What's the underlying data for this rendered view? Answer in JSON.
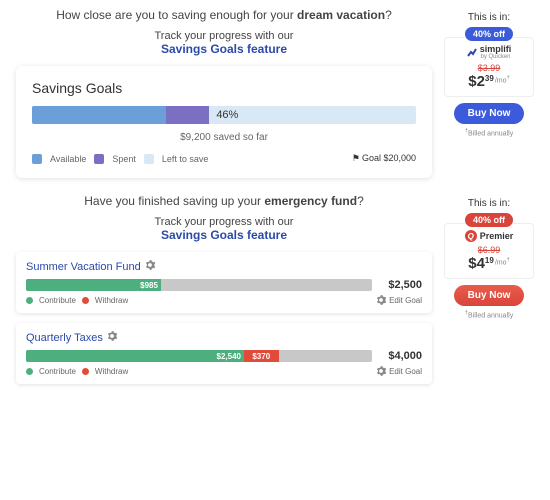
{
  "section1": {
    "prompt_pre": "How close are you to saving enough for your ",
    "prompt_bold": "dream vacation",
    "prompt_post": "?",
    "tagline": "Track your progress with our",
    "feature": "Savings Goals feature",
    "card": {
      "title": "Savings Goals",
      "pct": "46%",
      "saved": "$9,200 saved so far",
      "legend_available": "Available",
      "legend_spent": "Spent",
      "legend_left": "Left to save",
      "goal": "Goal $20,000"
    },
    "offer": {
      "this_in": "This is in:",
      "pct_off": "40% off",
      "brand": "simplifi",
      "brand_sub": "by Quicken",
      "old_price": "$3.99",
      "price_main": "$2",
      "price_cents": "39",
      "per": "/mo",
      "per_sup": "†",
      "buy": "Buy Now",
      "bill": "Billed annually",
      "bill_sup": "†"
    }
  },
  "section2": {
    "prompt_pre": "Have you finished saving up your ",
    "prompt_bold": "emergency fund",
    "prompt_post": "?",
    "tagline": "Track your progress with our",
    "feature": "Savings Goals feature",
    "goals": [
      {
        "name": "Summer Vacation Fund",
        "green": "$985",
        "green_w": 39,
        "red": "",
        "red_w": 0,
        "total": "$2,500"
      },
      {
        "name": "Quarterly Taxes",
        "green": "$2,540",
        "green_w": 63,
        "red": "$370",
        "red_w": 10,
        "total": "$4,000"
      }
    ],
    "legend": {
      "contribute": "Contribute",
      "withdraw": "Withdraw",
      "edit": "Edit Goal"
    },
    "offer": {
      "this_in": "This is in:",
      "pct_off": "40% off",
      "brand": "Premier",
      "old_price": "$6.99",
      "price_main": "$4",
      "price_cents": "19",
      "per": "/mo",
      "per_sup": "†",
      "buy": "Buy Now",
      "bill": "Billed annually",
      "bill_sup": "†"
    }
  }
}
